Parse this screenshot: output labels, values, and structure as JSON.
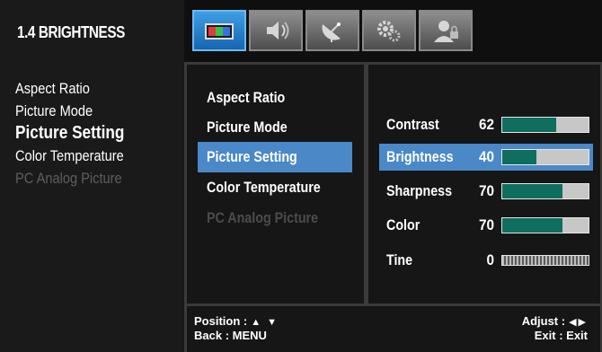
{
  "help_panel": {
    "title": "1.4 BRIGHTNESS",
    "items": [
      {
        "label": "Aspect Ratio",
        "state": "normal"
      },
      {
        "label": "Picture Mode",
        "state": "normal"
      },
      {
        "label": "Picture Setting",
        "state": "active"
      },
      {
        "label": "Color Temperature",
        "state": "normal"
      },
      {
        "label": "PC Analog Picture",
        "state": "disabled"
      }
    ]
  },
  "tabs": [
    {
      "name": "picture-tab",
      "icon": "picture-icon",
      "active": true
    },
    {
      "name": "sound-tab",
      "icon": "speaker-icon",
      "active": false
    },
    {
      "name": "channel-tab",
      "icon": "satellite-dish-icon",
      "active": false
    },
    {
      "name": "setup-tab",
      "icon": "gear-icon",
      "active": false
    },
    {
      "name": "parental-tab",
      "icon": "user-lock-icon",
      "active": false
    }
  ],
  "menu": {
    "items": [
      {
        "label": "Aspect Ratio",
        "state": "normal"
      },
      {
        "label": "Picture Mode",
        "state": "normal"
      },
      {
        "label": "Picture Setting",
        "state": "selected"
      },
      {
        "label": "Color Temperature",
        "state": "normal"
      },
      {
        "label": "PC Analog Picture",
        "state": "disabled"
      }
    ]
  },
  "settings": {
    "items": [
      {
        "label": "Contrast",
        "value": "62",
        "level": 0.62,
        "selected": false,
        "style": "solid"
      },
      {
        "label": "Brightness",
        "value": "40",
        "level": 0.4,
        "selected": true,
        "style": "solid"
      },
      {
        "label": "Sharpness",
        "value": "70",
        "level": 0.7,
        "selected": false,
        "style": "solid"
      },
      {
        "label": "Color",
        "value": "70",
        "level": 0.7,
        "selected": false,
        "style": "solid"
      },
      {
        "label": "Tine",
        "value": "0",
        "level": 0.0,
        "selected": false,
        "style": "dotted"
      }
    ]
  },
  "footer": {
    "position_label": "Position :",
    "position_arrows": "▲ ▼",
    "back_label": "Back : MENU",
    "adjust_label": "Adjust :",
    "adjust_arrows": "◀▶",
    "exit_label": "Exit : Exit"
  },
  "colors": {
    "selection": "#4a88c7",
    "bar_fill": "#0f6e5e",
    "bar_track": "#c7c7c7",
    "active_tab": "#2a86d6"
  }
}
